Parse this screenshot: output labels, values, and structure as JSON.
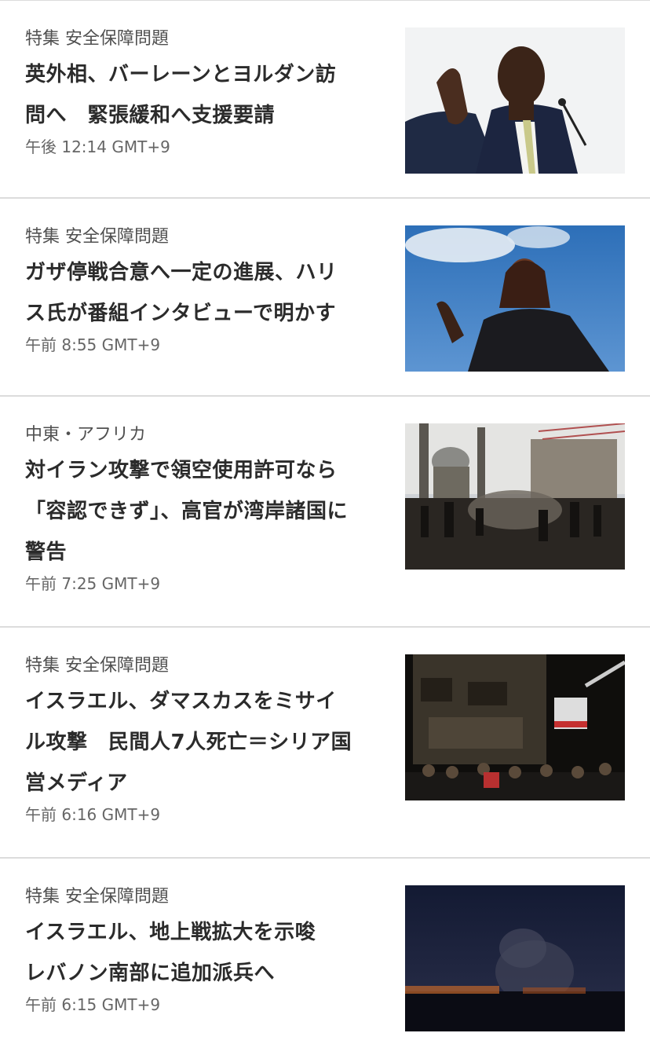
{
  "stories": [
    {
      "kicker": "特集 安全保障問題",
      "headline": "英外相、バーレーンとヨルダン訪\n問へ　緊張緩和へ支援要請",
      "time": "午後 12:14 GMT+9",
      "image": "photo-minister-speaking-at-microphone"
    },
    {
      "kicker": "特集 安全保障問題",
      "headline": "ガザ停戦合意へ一定の進展、ハリ\nス氏が番組インタビューで明かす",
      "time": "午前 8:55 GMT+9",
      "image": "photo-woman-against-blue-sky"
    },
    {
      "kicker": "中東・アフリカ",
      "headline": "対イラン攻撃で領空使用許可なら\n「容認できず」、高官が湾岸諸国に\n警告",
      "time": "午前 7:25 GMT+9",
      "image": "photo-crowd-near-mosque"
    },
    {
      "kicker": "特集 安全保障問題",
      "headline": "イスラエル、ダマスカスをミサイ\nル攻撃　民間人7人死亡＝シリア国\n営メディア",
      "time": "午前 6:16 GMT+9",
      "image": "photo-damaged-building-at-night"
    },
    {
      "kicker": "特集 安全保障問題",
      "headline": "イスラエル、地上戦拡大を示唆\nレバノン南部に追加派兵へ",
      "time": "午前 6:15 GMT+9",
      "image": "photo-smoke-over-city-at-night"
    }
  ]
}
